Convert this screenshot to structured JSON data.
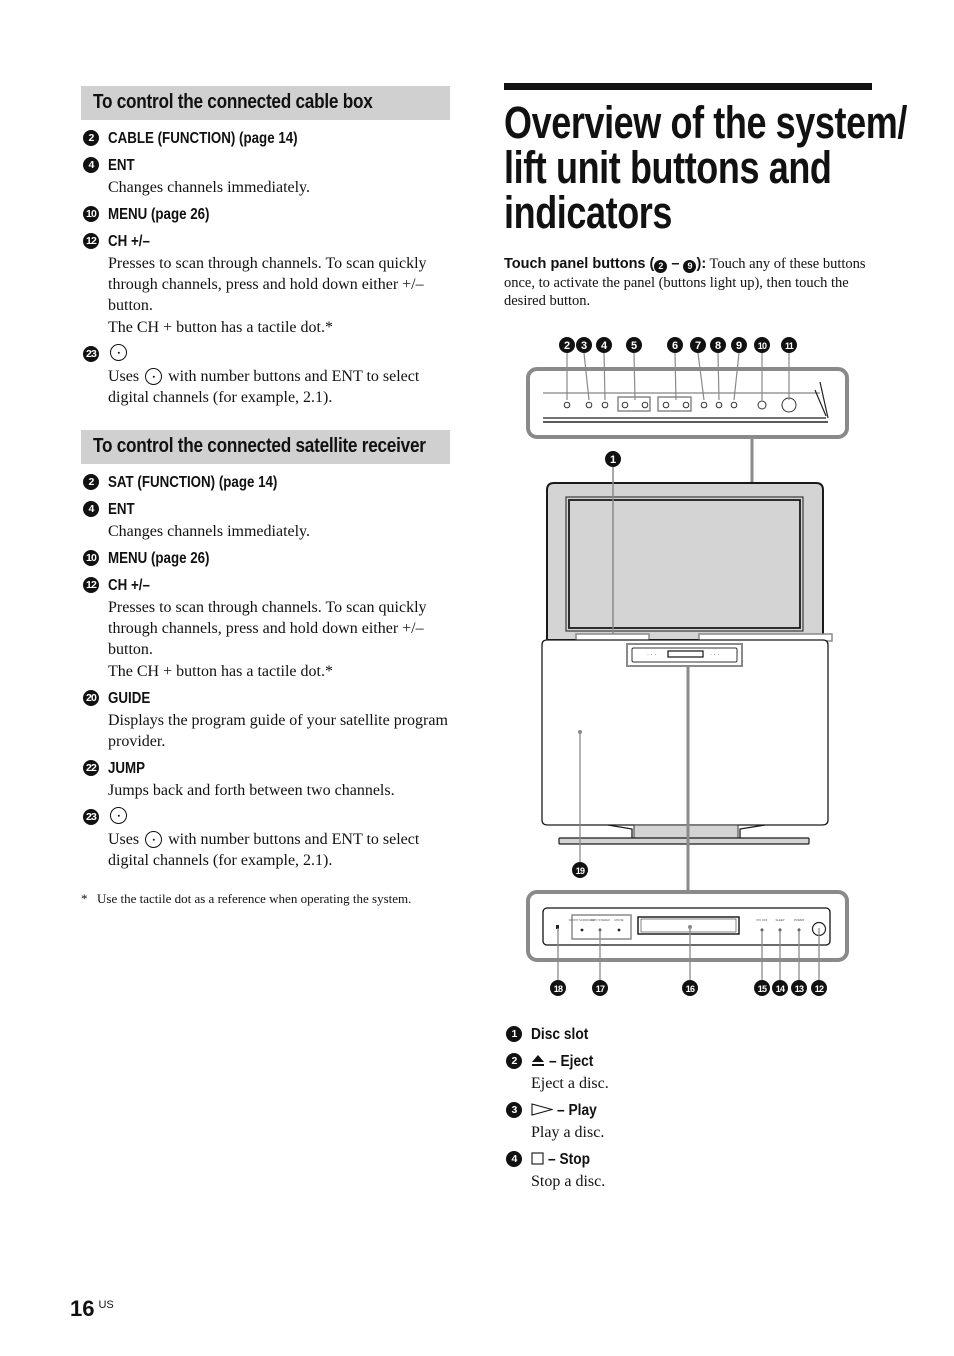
{
  "left": {
    "cable_section": {
      "heading": "To control the connected cable box",
      "items": [
        {
          "num": "2",
          "title": "CABLE (FUNCTION) (page 14)",
          "desc": []
        },
        {
          "num": "4",
          "title": "ENT",
          "desc": [
            "Changes channels immediately."
          ]
        },
        {
          "num": "10",
          "title": "MENU (page 26)",
          "desc": []
        },
        {
          "num": "12",
          "title": "CH +/–",
          "desc": [
            "Presses to scan through channels. To scan quickly through channels, press and hold down either +/– button.",
            "The CH + button has a tactile dot.*"
          ]
        },
        {
          "num": "23",
          "title": "",
          "icon": "dot-button-icon",
          "desc_pre": "Uses",
          "desc_post": "with number buttons and ENT to select digital channels (for example, 2.1)."
        }
      ]
    },
    "satellite_section": {
      "heading": "To control the connected satellite receiver",
      "items": [
        {
          "num": "2",
          "title": "SAT (FUNCTION) (page 14)",
          "desc": []
        },
        {
          "num": "4",
          "title": "ENT",
          "desc": [
            "Changes channels immediately."
          ]
        },
        {
          "num": "10",
          "title": "MENU (page 26)",
          "desc": []
        },
        {
          "num": "12",
          "title": "CH +/–",
          "desc": [
            "Presses to scan through channels. To scan quickly through channels, press and hold down either +/– button.",
            "The CH + button has a tactile dot.*"
          ]
        },
        {
          "num": "20",
          "title": "GUIDE",
          "desc": [
            "Displays the program guide of your satellite program provider."
          ]
        },
        {
          "num": "22",
          "title": "JUMP",
          "desc": [
            "Jumps back and forth between two channels."
          ]
        },
        {
          "num": "23",
          "title": "",
          "icon": "dot-button-icon",
          "desc_pre": "Uses",
          "desc_post": "with number buttons and ENT to select digital channels (for example, 2.1)."
        }
      ]
    },
    "footnote": {
      "mark": "*",
      "text": "Use the tactile dot as a reference when operating the system."
    }
  },
  "right": {
    "title_lines": [
      "Overview of the system/",
      "lift unit buttons and",
      "indicators"
    ],
    "intro": {
      "bold_prefix": "Touch panel buttons (",
      "range_start": "2",
      "range_sep": " – ",
      "range_end": "9",
      "bold_suffix": "):",
      "text": " Touch any of these buttons once, to activate the panel (buttons light up), then touch the desired button."
    },
    "diagram": {
      "top_callouts": [
        "2",
        "3",
        "4",
        "5",
        "6",
        "7",
        "8",
        "9",
        "10",
        "11"
      ],
      "screen_callout": "1",
      "body_callout": "19",
      "bottom_callouts": [
        "18",
        "17",
        "16",
        "15",
        "14",
        "13",
        "12"
      ],
      "bottom_panel_labels": [
        "FRONT SURROUND",
        "AUTO STEREO",
        "MOVIE",
        "PIC OFF",
        "SLEEP",
        "POWER"
      ],
      "colors": {
        "panel_gray": "#d4d4d4",
        "leader_gray": "#8a8a8a",
        "outline": "#1a1a1a"
      }
    },
    "legend": [
      {
        "num": "1",
        "title": "Disc slot",
        "icon": "",
        "desc": ""
      },
      {
        "num": "2",
        "title": "– Eject",
        "icon": "eject-icon",
        "desc": "Eject a disc."
      },
      {
        "num": "3",
        "title": "– Play",
        "icon": "play-icon",
        "desc": "Play a disc."
      },
      {
        "num": "4",
        "title": "– Stop",
        "icon": "stop-icon",
        "desc": "Stop a disc."
      }
    ]
  },
  "page": {
    "number": "16",
    "region": "US"
  }
}
